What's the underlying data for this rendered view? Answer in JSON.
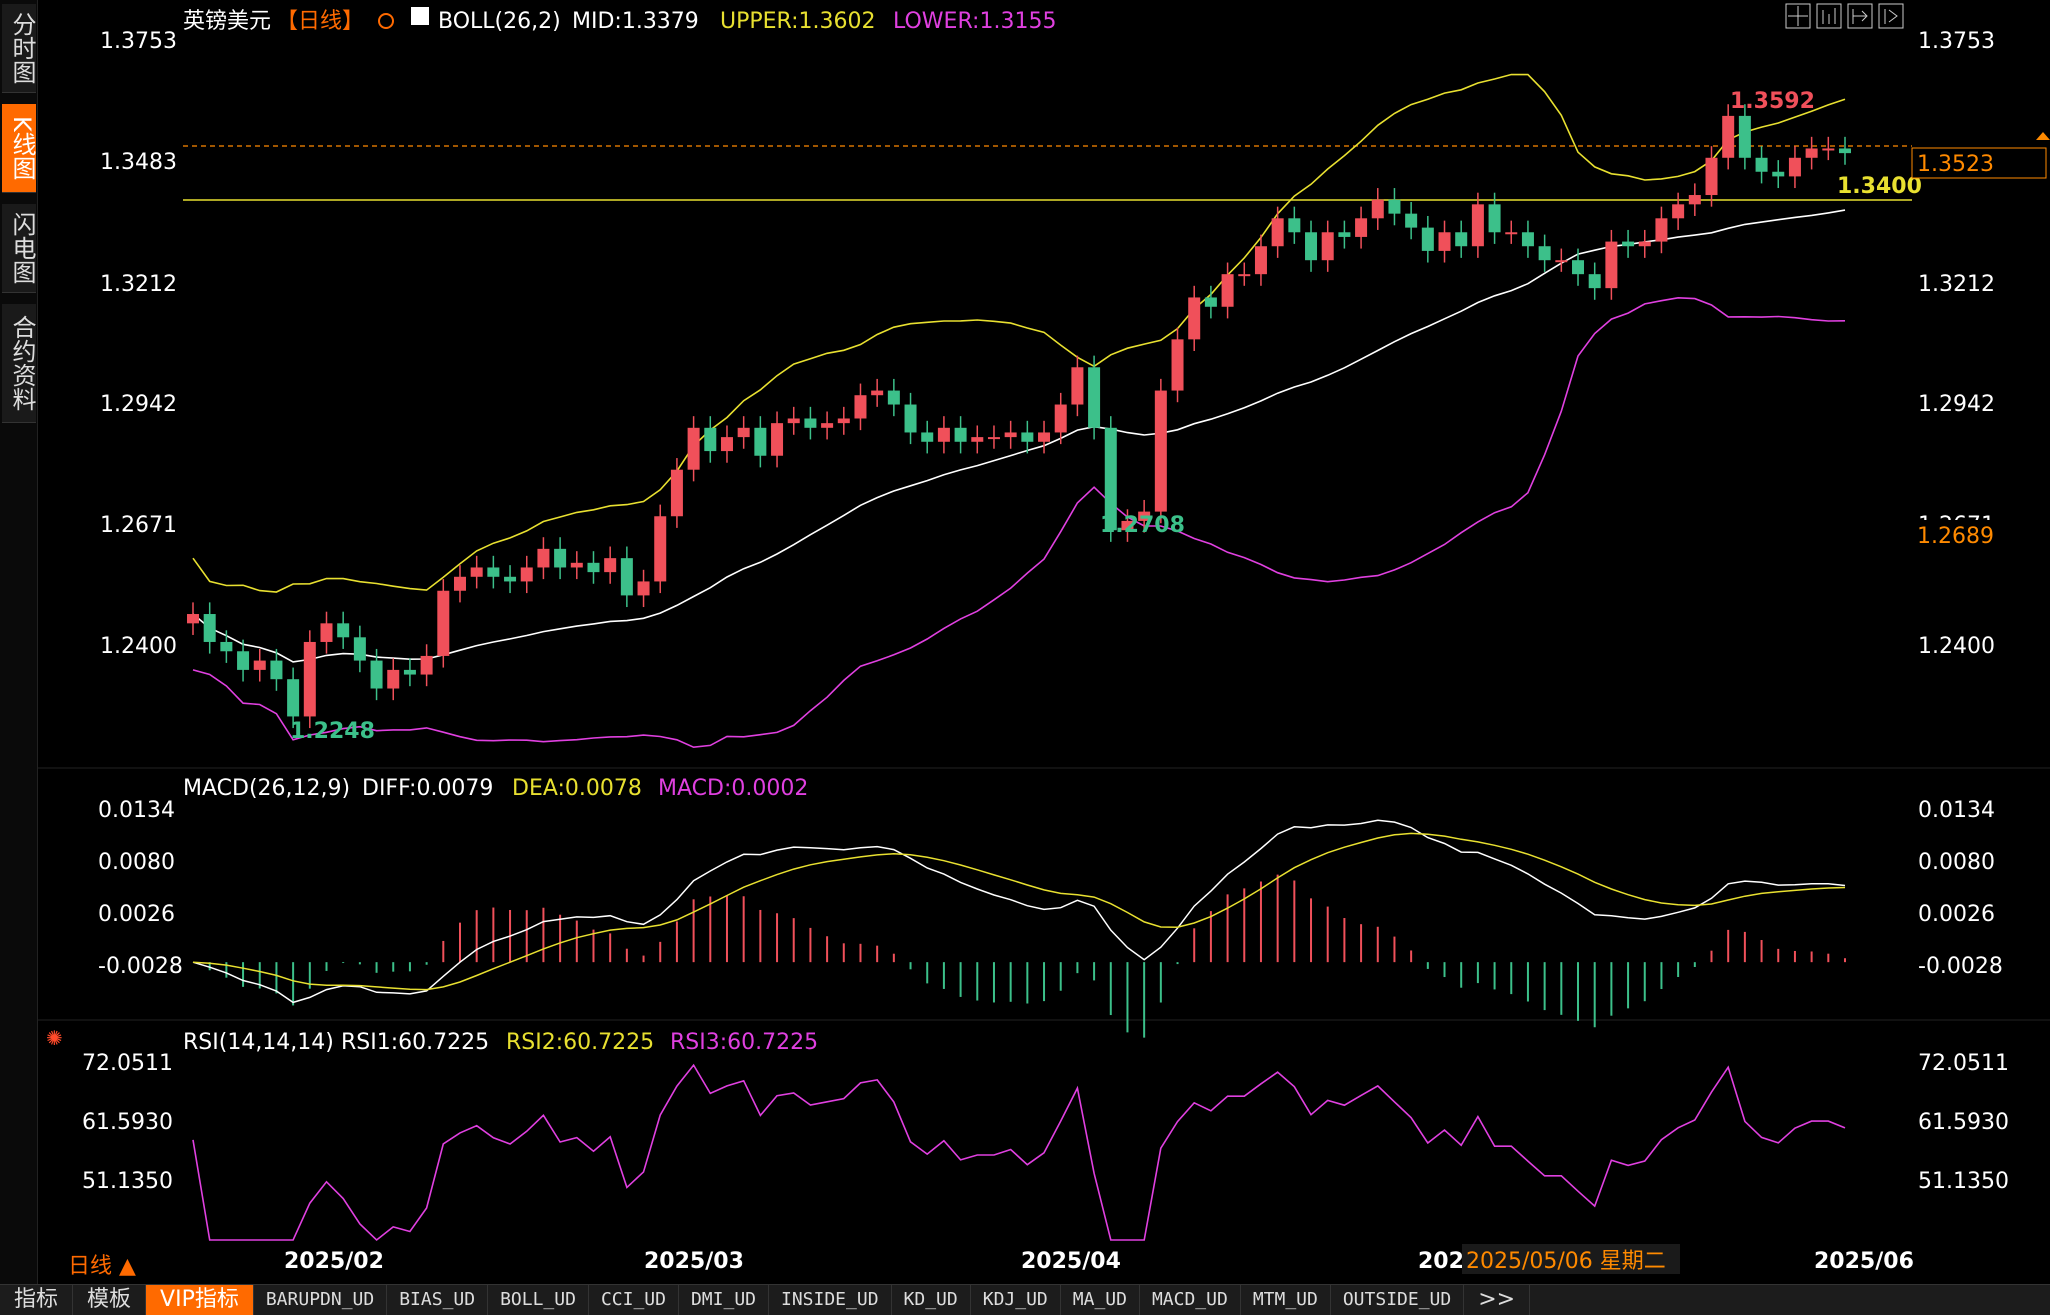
{
  "sidebar": {
    "tabs": [
      {
        "label": "分时图",
        "active": false
      },
      {
        "label": "K线图",
        "active": true
      },
      {
        "label": "闪电图",
        "active": false
      },
      {
        "label": "合约资料",
        "active": false
      }
    ]
  },
  "header": {
    "instrument": "英镑美元",
    "period_tag": "【日线】",
    "boll_label": "BOLL(26,2)",
    "mid": "MID:1.3379",
    "upper": "UPPER:1.3602",
    "lower": "LOWER:1.3155"
  },
  "toolbar_icons": [
    "grid-icon",
    "bar-chart-icon",
    "chart-settings-icon",
    "arrow-right-icon"
  ],
  "main_chart": {
    "y_labels": [
      "1.3753",
      "1.3483",
      "1.3212",
      "1.2942",
      "1.2671",
      "1.2400"
    ],
    "annotations": {
      "high": "1.3592",
      "low1": "1.2708",
      "low2": "1.2248",
      "level": "1.3400"
    },
    "price_tags": {
      "current": "1.3523",
      "other": "1.2689"
    }
  },
  "macd": {
    "label": "MACD(26,12,9)",
    "diff": "DIFF:0.0079",
    "dea": "DEA:0.0078",
    "macd": "MACD:0.0002",
    "y_labels": [
      "0.0134",
      "0.0080",
      "0.0026",
      "-0.0028"
    ]
  },
  "rsi": {
    "label": "RSI(14,14,14)",
    "rsi1": "RSI1:60.7225",
    "rsi2": "RSI2:60.7225",
    "rsi3": "RSI3:60.7225",
    "y_labels": [
      "72.0511",
      "61.5930",
      "51.1350"
    ]
  },
  "x_axis": {
    "labels": [
      "2025/02",
      "2025/03",
      "2025/04",
      "202",
      "2025/06"
    ],
    "crosshair_date": "2025/05/06 星期二"
  },
  "period_selector": "日线 ▲",
  "bottom_tabs": [
    "指标",
    "模板",
    "VIP指标",
    "BARUPDN_UD",
    "BIAS_UD",
    "BOLL_UD",
    "CCI_UD",
    "DMI_UD",
    "INSIDE_UD",
    "KD_UD",
    "KDJ_UD",
    "MA_UD",
    "MACD_UD",
    "MTM_UD",
    "OUTSIDE_UD",
    ">>"
  ],
  "colors": {
    "up": "#f0505a",
    "down": "#3cc08a",
    "upper": "#e8e030",
    "lower": "#e040e0",
    "mid": "#ffffff",
    "accent": "#ff6a00"
  },
  "chart_data": {
    "type": "candlestick",
    "ylim": [
      1.22,
      1.3753
    ],
    "close": [
      1.252,
      1.246,
      1.244,
      1.24,
      1.242,
      1.238,
      1.23,
      1.246,
      1.25,
      1.247,
      1.242,
      1.236,
      1.24,
      1.239,
      1.243,
      1.257,
      1.26,
      1.262,
      1.26,
      1.259,
      1.262,
      1.266,
      1.262,
      1.263,
      1.261,
      1.264,
      1.256,
      1.259,
      1.273,
      1.283,
      1.292,
      1.287,
      1.29,
      1.292,
      1.286,
      1.293,
      1.294,
      1.292,
      1.293,
      1.294,
      1.299,
      1.3,
      1.297,
      1.291,
      1.289,
      1.292,
      1.289,
      1.29,
      1.29,
      1.291,
      1.289,
      1.291,
      1.297,
      1.305,
      1.292,
      1.27,
      1.272,
      1.274,
      1.3,
      1.311,
      1.32,
      1.318,
      1.325,
      1.325,
      1.331,
      1.337,
      1.334,
      1.328,
      1.334,
      1.333,
      1.337,
      1.341,
      1.338,
      1.335,
      1.33,
      1.334,
      1.331,
      1.34,
      1.334,
      1.334,
      1.331,
      1.328,
      1.328,
      1.325,
      1.322,
      1.332,
      1.331,
      1.332,
      1.337,
      1.34,
      1.342,
      1.35,
      1.359,
      1.35,
      1.347,
      1.346,
      1.35,
      1.352,
      1.352,
      1.351
    ]
  }
}
